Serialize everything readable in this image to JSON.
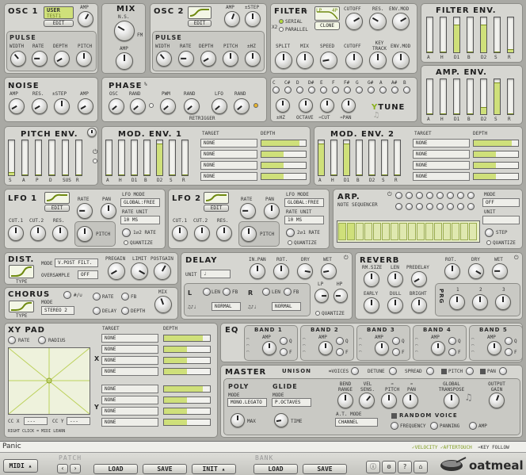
{
  "osc1": {
    "title": "OSC 1",
    "wave": "USER",
    "wave2": "TEST1",
    "edit": "EDIT",
    "amp": "AMP",
    "pulse": "PULSE",
    "width": "WIDTH",
    "rate": "RATE",
    "depth": "DEPTH",
    "pitch": "PITCH"
  },
  "mix": {
    "title": "MIX",
    "ns": "N.S.",
    "fm": "FM",
    "amp": "AMP"
  },
  "osc2": {
    "title": "OSC 2",
    "edit": "EDIT",
    "amp": "AMP",
    "step": "±STEP",
    "pulse": "PULSE",
    "width": "WIDTH",
    "rate": "RATE",
    "depth": "DEPTH",
    "pitch": "PITCH",
    "hz": "±HZ"
  },
  "filter": {
    "title": "FILTER",
    "serial": "SERIAL",
    "parallel": "PARALLEL",
    "x2": "X2",
    "lp": "LP",
    "fourp": "4P",
    "clone": "CLONE",
    "cutoff": "CUTOFF",
    "res": "RES.",
    "envmod": "ENV.MOD",
    "split": "SPLIT",
    "mix": "MIX",
    "speed": "SPEED",
    "keytrack": "KEY TRACK",
    "cutoff2": "CUTOFF",
    "envmod2": "ENV.MOD"
  },
  "filter_env": {
    "title": "FILTER ENV.",
    "labels": [
      "A",
      "H",
      "D1",
      "B",
      "D2",
      "S",
      "R"
    ],
    "values": [
      0.0,
      0.0,
      0.8,
      0.0,
      0.8,
      0.0,
      0.1
    ]
  },
  "amp_env": {
    "title": "AMP. ENV.",
    "labels": [
      "A",
      "H",
      "D1",
      "B",
      "D2",
      "S",
      "R"
    ],
    "values": [
      0.0,
      0.0,
      0.0,
      0.0,
      0.2,
      0.9,
      0.0
    ]
  },
  "noise": {
    "title": "NOISE",
    "amp": "AMP",
    "res": "RES.",
    "step": "±STEP",
    "amp2": "AMP"
  },
  "phase": {
    "title": "PHASE",
    "pct": "%",
    "osc": "OSC",
    "rand": "RAND",
    "pwm": "PWM",
    "rand2": "RAND",
    "lfo": "LFO",
    "rand3": "RAND",
    "retrigger": "RETRIGGER"
  },
  "tune": {
    "notes": [
      "C",
      "C#",
      "D",
      "D#",
      "E",
      "F",
      "F#",
      "G",
      "G#",
      "A",
      "A#",
      "B"
    ],
    "hz": "±HZ",
    "octave": "OCTAVE",
    "cut": "CUT",
    "pan": "PAN",
    "label": "TUNE"
  },
  "pitch_env": {
    "title": "PITCH ENV.",
    "labels": [
      "S",
      "A",
      "P",
      "D",
      "SUS",
      "R"
    ],
    "values": [
      0.1,
      0.0,
      0.0,
      0.0,
      0.0,
      0.0
    ]
  },
  "mod_env1": {
    "title": "MOD. ENV. 1",
    "labels": [
      "A",
      "H",
      "D1",
      "B",
      "D2",
      "S",
      "R"
    ],
    "values": [
      0.0,
      0.0,
      0.0,
      0.0,
      0.9,
      0.0,
      0.0
    ],
    "target": "TARGET",
    "depth": "DEPTH",
    "rows": [
      "NONE",
      "NONE",
      "NONE",
      "NONE"
    ],
    "depths": [
      0.85,
      0.5,
      0.5,
      0.5
    ]
  },
  "mod_env2": {
    "title": "MOD. ENV. 2",
    "labels": [
      "A",
      "H",
      "D1",
      "B",
      "D2",
      "S",
      "R"
    ],
    "values": [
      0.9,
      0.0,
      0.9,
      0.0,
      0.0,
      0.0,
      0.0
    ],
    "target": "TARGET",
    "depth": "DEPTH",
    "rows": [
      "NONE",
      "NONE",
      "NONE",
      "NONE"
    ],
    "depths": [
      0.85,
      0.5,
      0.5,
      0.5
    ]
  },
  "lfo1": {
    "title": "LFO 1",
    "edit": "EDIT",
    "rate": "RATE",
    "pan": "PAN",
    "mode_l": "LFO MODE",
    "mode": "GLOBAL:FREE",
    "unit_l": "RATE UNIT",
    "unit": "10 MS",
    "cut1": "CUT.1",
    "cut2": "CUT.2",
    "res": "RES.",
    "pitch": "PITCH",
    "rate2": "1⇄2 RATE",
    "quantize": "QUANTIZE"
  },
  "lfo2": {
    "title": "LFO 2",
    "edit": "EDIT",
    "rate": "RATE",
    "pan": "PAN",
    "mode_l": "LFO MODE",
    "mode": "GLOBAL:FREE",
    "unit_l": "RATE UNIT",
    "unit": "10 MS",
    "cut1": "CUT.1",
    "cut2": "CUT.2",
    "res": "RES.",
    "pitch": "PITCH",
    "rate2": "2⇄1 RATE",
    "quantize": "QUANTIZE"
  },
  "arp": {
    "title": "ARP.",
    "seq": "NOTE SEQUENCER",
    "mode_l": "MODE",
    "mode": "OFF",
    "unit_l": "UNIT",
    "unit": "",
    "step": "STEP",
    "quantize": "QUANTIZE"
  },
  "dist": {
    "title": "DIST.",
    "mode_l": "MODE",
    "mode": "V.POST FILT.",
    "over_l": "OVERSAMPLE",
    "over": "OFF",
    "type": "TYPE",
    "pregain": "PREGAIN",
    "limit": "LIMIT",
    "postgain": "POSTGAIN"
  },
  "delay": {
    "title": "DELAY",
    "unit_l": "UNIT",
    "inpan": "IN.PAN",
    "rot": "ROT.",
    "dry": "DRY",
    "wet": "WET",
    "l": "L",
    "r": "R",
    "len": "LEN",
    "fb": "FB",
    "normal": "NORMAL",
    "lp": "LP",
    "hp": "HP",
    "quantize": "QUANTIZE"
  },
  "chorus": {
    "title": "CHORUS",
    "mode_l": "MODE",
    "mode": "STEREO 2",
    "type": "TYPE",
    "rate": "RATE",
    "fb": "FB",
    "delay": "DELAY",
    "depth": "DEPTH",
    "mix": "MIX"
  },
  "reverb": {
    "title": "REVERB",
    "rmsize": "RM.SIZE",
    "len": "LEN",
    "predelay": "PREDELAY",
    "rot": "ROT.",
    "dry": "DRY",
    "wet": "WET",
    "early": "EARLY",
    "dull": "DULL",
    "bright": "BRIGHT",
    "prg": "PRG",
    "c1": "1",
    "c2": "2",
    "c3": "3"
  },
  "xypad": {
    "title": "XY PAD",
    "rate": "RATE",
    "radius": "RADIUS",
    "target": "TARGET",
    "depth": "DEPTH",
    "x": "X",
    "y": "Y",
    "rows_x": [
      "NONE",
      "NONE",
      "NONE",
      "NONE"
    ],
    "rows_y": [
      "NONE",
      "NONE",
      "NONE",
      "NONE"
    ],
    "depths": [
      0.85,
      0.5,
      0.5,
      0.5
    ],
    "ccx": "CC X",
    "ccy": "CC Y",
    "dash": "---",
    "learn": "RIGHT CLICK = MIDI LEARN"
  },
  "eq": {
    "title": "EQ",
    "bands": [
      "BAND 1",
      "BAND 2",
      "BAND 3",
      "BAND 4",
      "BAND 5"
    ],
    "amp": "AMP",
    "q": "Q",
    "f": "F"
  },
  "master": {
    "title": "MASTER",
    "unison": "UNISON",
    "voices": "VOICES",
    "detune": "DETUNE",
    "spread": "SPREAD",
    "pitch": "PITCH",
    "pan": "PAN",
    "poly": "POLY",
    "glide": "GLIDE",
    "mode_l": "MODE",
    "mode1": "MONO.LEGATO",
    "mode2": "P.OCTAVES",
    "max": "MAX",
    "time": "TIME",
    "bend": "BEND RANGE",
    "vel": "VEL SENS.",
    "pitch2": "PITCH",
    "pan2": "PAN",
    "global": "GLOBAL TRANSPOSE",
    "gain": "OUTPUT GAIN",
    "at_l": "A.T. MODE",
    "at": "CHANNEL",
    "random": "RANDOM VOICE",
    "freq": "FREQUENCY",
    "panning": "PANNING",
    "amp": "AMP"
  },
  "status": {
    "panic": "Panic",
    "velocity": "VELOCITY",
    "aftertouch": "AFTERTOUCH",
    "keyfollow": "KEY FOLLOW"
  },
  "bottom": {
    "midi": "MIDI",
    "patch": "PATCH",
    "bank": "BANK",
    "load": "LOAD",
    "save": "SAVE",
    "init": "INIT",
    "load2": "LOAD",
    "save2": "SAVE",
    "logo": "oatmeal"
  }
}
